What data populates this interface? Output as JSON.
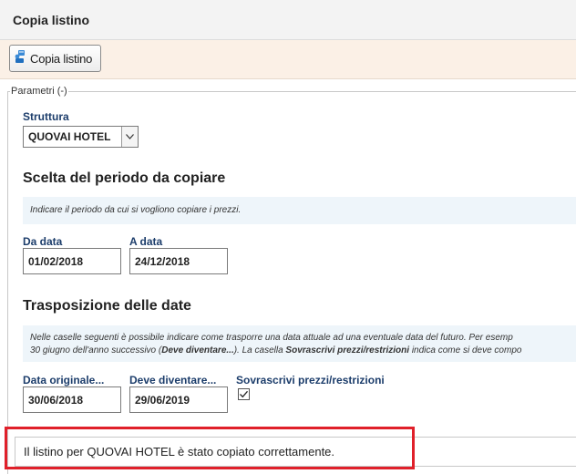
{
  "window": {
    "title": "Copia listino"
  },
  "toolbar": {
    "copy_button_label": "Copia listino",
    "copy_button_icon": "copy-pricelist-icon"
  },
  "parameters": {
    "legend": "Parametri (-)"
  },
  "structure": {
    "label": "Struttura",
    "selected": "QUOVAI HOTEL"
  },
  "period": {
    "title": "Scelta del periodo da copiare",
    "info": "Indicare il periodo da cui si vogliono copiare i prezzi.",
    "from_label": "Da data",
    "from_value": "01/02/2018",
    "to_label": "A data",
    "to_value": "24/12/2018"
  },
  "transposition": {
    "title": "Trasposizione delle date",
    "info_line1": "Nelle caselle seguenti è possibile indicare come trasporre una data attuale ad una eventuale data del futuro. Per esemp",
    "info_line2_a": "30 giugno dell'anno successivo (",
    "info_line2_b": "Deve diventare...",
    "info_line2_c": "). La casella ",
    "info_line2_d": "Sovrascrivi prezzi/restrizioni",
    "info_line2_e": " indica come si deve compo",
    "original_label": "Data originale...",
    "original_value": "30/06/2018",
    "become_label": "Deve diventare...",
    "become_value": "29/06/2019",
    "overwrite_label": "Sovrascrivi prezzi/restrizioni",
    "overwrite_checked": true
  },
  "message": {
    "text": "Il listino per QUOVAI HOTEL è stato copiato correttamente."
  },
  "colors": {
    "highlight": "#e0202a",
    "label_blue": "#1c3d6b",
    "toolbar_bg": "#fbf0e6",
    "info_bg": "#eef5fa"
  }
}
